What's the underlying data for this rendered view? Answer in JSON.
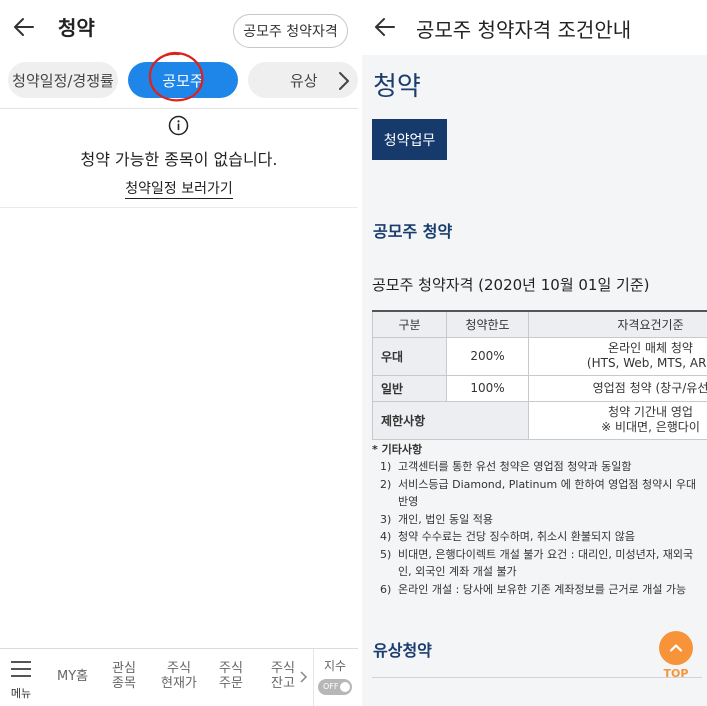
{
  "left": {
    "header": {
      "title": "청약",
      "qualification_button": "공모주 청약자격"
    },
    "tabs": [
      {
        "label": "청약일정/경쟁률",
        "selected": false
      },
      {
        "label": "공모주",
        "selected": true
      },
      {
        "label": "유상",
        "selected": false
      }
    ],
    "empty_message": "청약 가능한 종목이 없습니다.",
    "schedule_link": "청약일정 보러가기",
    "bottom_nav": {
      "menu_label": "메뉴",
      "items": [
        {
          "line1": "MY홈",
          "line2": ""
        },
        {
          "line1": "관심",
          "line2": "종목"
        },
        {
          "line1": "주식",
          "line2": "현재가"
        },
        {
          "line1": "주식",
          "line2": "주문"
        },
        {
          "line1": "주식",
          "line2": "잔고"
        }
      ],
      "index_label": "지수",
      "toggle_state": "OFF"
    }
  },
  "right": {
    "header": {
      "title": "공모주 청약자격 조건안내"
    },
    "section_big": "청약",
    "biz_button": "청약업무",
    "ipo_section_title": "공모주 청약",
    "qualification_title": "공모주 청약자격 (2020년 10월 01일 기준)",
    "table": {
      "headers": [
        "구분",
        "청약한도",
        "자격요건기준"
      ],
      "rows": [
        {
          "type": "우대",
          "limit": "200%",
          "req1": "온라인 매체 청약",
          "req2": "(HTS, Web, MTS, ARS"
        },
        {
          "type": "일반",
          "limit": "100%",
          "req1": "영업점 청약 (창구/유선",
          "req2": ""
        },
        {
          "type": "제한사항",
          "limit": "",
          "req1": "청약 기간내 영업",
          "req2": "※ 비대면, 은행다이"
        }
      ]
    },
    "notes_title": "* 기타사항",
    "notes": [
      {
        "num": "1)",
        "text": "고객센터를 통한 유선 청약은 영업점 청약과 동일함"
      },
      {
        "num": "2)",
        "text": "서비스등급 Diamond, Platinum 에 한하여 영업점 청약시 우대 반영"
      },
      {
        "num": "3)",
        "text": "개인, 법인 동일 적용"
      },
      {
        "num": "4)",
        "text": "청약 수수료는 건당 징수하며, 취소시 환불되지 않음"
      },
      {
        "num": "5)",
        "text": "비대면, 은행다이렉트 개설 불가 요건 : 대리인, 미성년자, 재외국인, 외국인 계좌 개설 불가"
      },
      {
        "num": "6)",
        "text": "온라인 개설 : 당사에 보유한 기존 계좌정보를 근거로 개설 가능"
      }
    ],
    "rights_title": "유상청약",
    "top_label": "TOP"
  },
  "colors": {
    "selected_tab": "#1e86e8",
    "navy": "#163a6c",
    "section_text": "#1a3d6e",
    "top_button": "#f7943a",
    "annotation_circle": "#e0201a"
  },
  "icons": [
    "back-arrow-icon",
    "chevron-right-icon",
    "info-icon",
    "hamburger-menu-icon",
    "chevron-up-icon"
  ]
}
